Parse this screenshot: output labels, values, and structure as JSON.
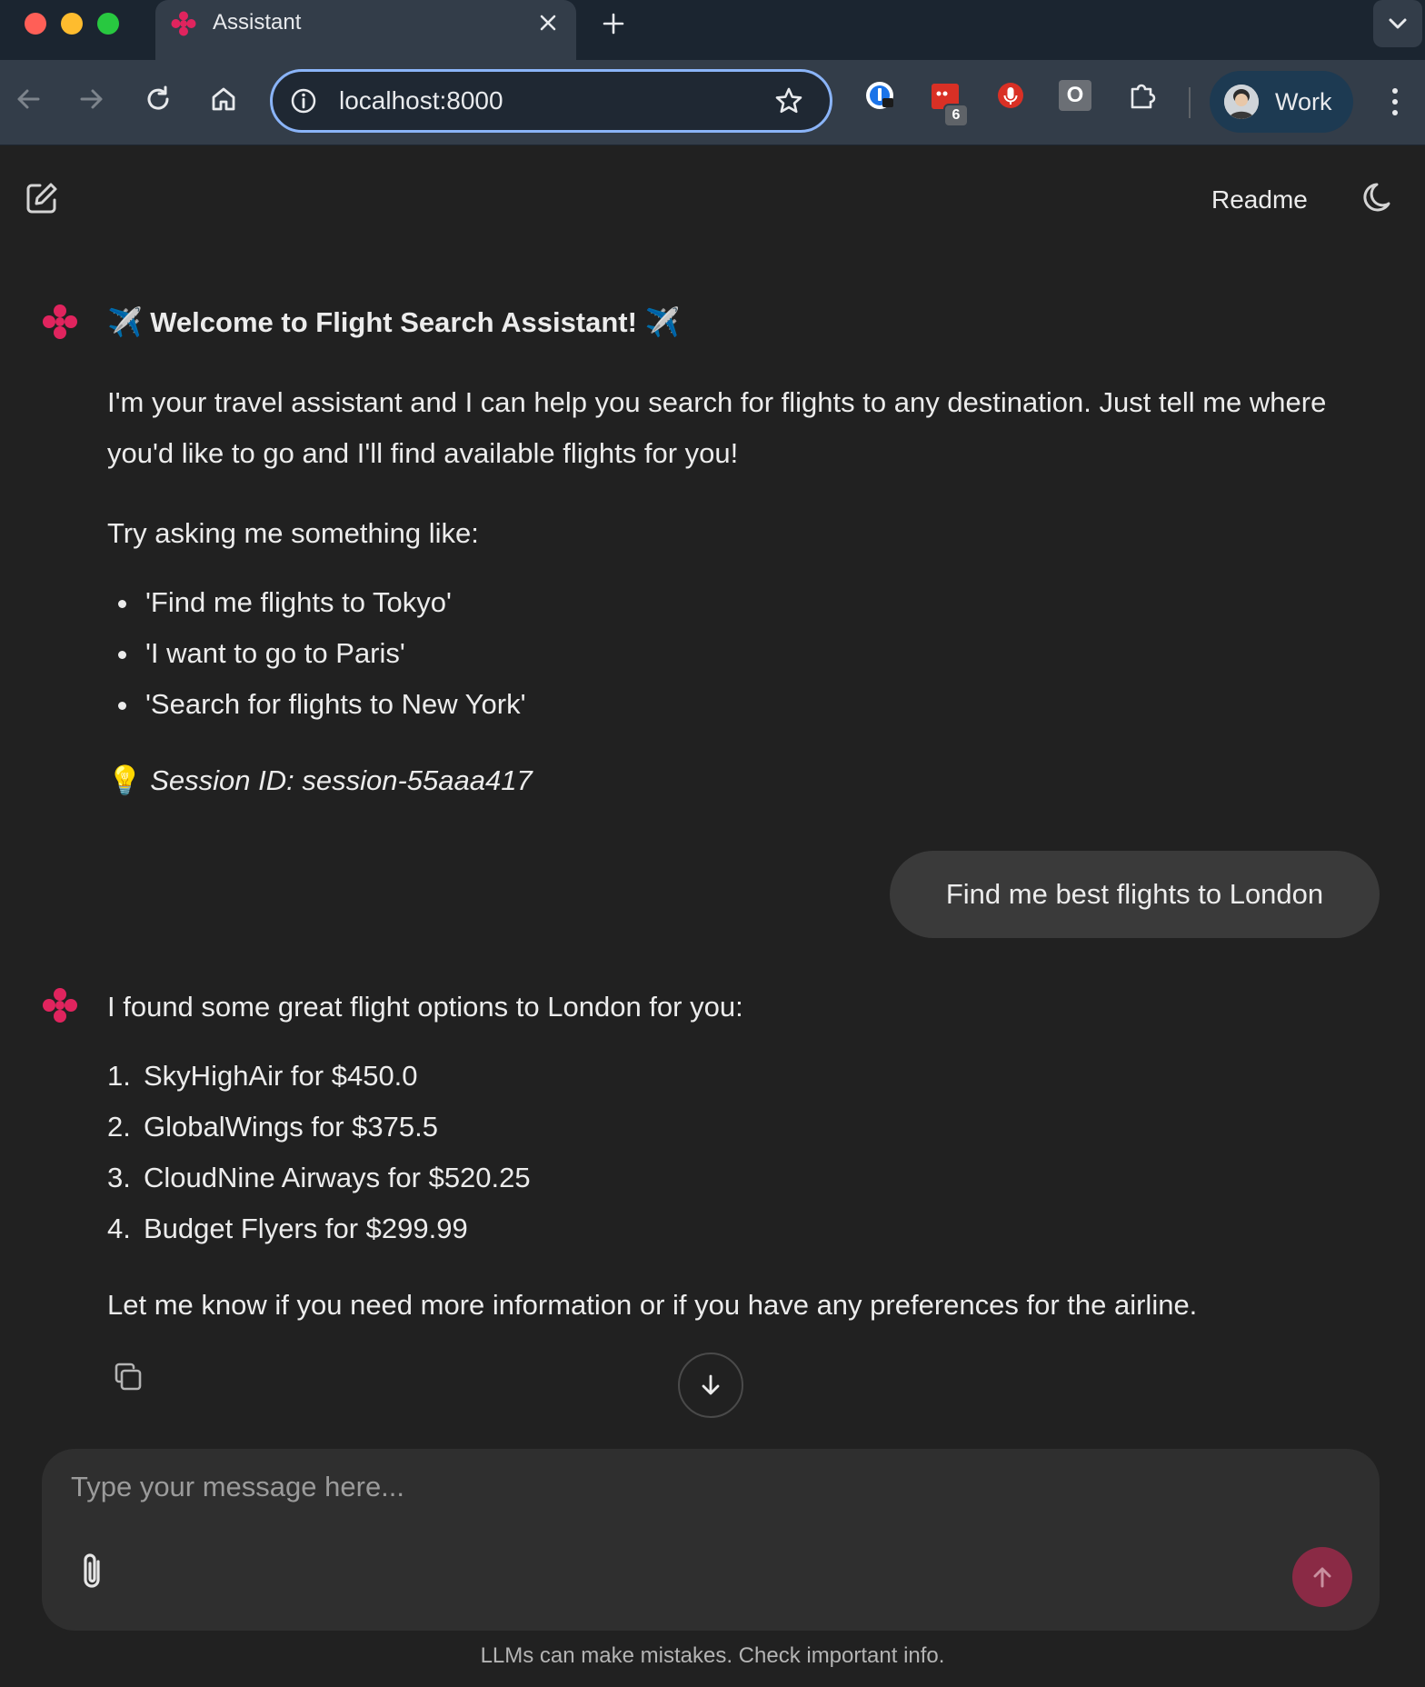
{
  "browser": {
    "tab_title": "Assistant",
    "url": "localhost:8000",
    "extension_badge_count": "6",
    "profile_name": "Work",
    "ext_o_letter": "O"
  },
  "header": {
    "readme_label": "Readme"
  },
  "welcome": {
    "title_prefix_emoji": "✈️",
    "title": "Welcome to Flight Search Assistant!",
    "title_suffix_emoji": "✈️",
    "intro": "I'm your travel assistant and I can help you search for flights to any destination. Just tell me where you'd like to go and I'll find available flights for you!",
    "try_label": "Try asking me something like:",
    "examples": [
      "'Find me flights to Tokyo'",
      "'I want to go to Paris'",
      "'Search for flights to New York'"
    ],
    "session_emoji": "💡",
    "session_text": "Session ID: session-55aaa417"
  },
  "user_message": {
    "text": "Find me best flights to London"
  },
  "reply": {
    "intro": "I found some great flight options to London for you:",
    "flights": [
      {
        "num": "1.",
        "text": "SkyHighAir for $450.0"
      },
      {
        "num": "2.",
        "text": "GlobalWings for $375.5"
      },
      {
        "num": "3.",
        "text": "CloudNine Airways for $520.25"
      },
      {
        "num": "4.",
        "text": "Budget Flyers for $299.99"
      }
    ],
    "outro": "Let me know if you need more information or if you have any preferences for the airline."
  },
  "composer": {
    "placeholder": "Type your message here...",
    "disclaimer": "LLMs can make mistakes. Check important info."
  },
  "colors": {
    "background": "#212121",
    "accent_logo": "#e0245e",
    "send_button": "#8a2a45",
    "user_bubble": "#3a3a3a"
  },
  "icons": {
    "logo": "pink-flower-logo-icon",
    "new_chat": "edit-icon",
    "theme": "moon-icon",
    "copy": "copy-icon",
    "scroll": "arrow-down-icon",
    "attach": "paperclip-icon",
    "send": "arrow-up-icon"
  }
}
